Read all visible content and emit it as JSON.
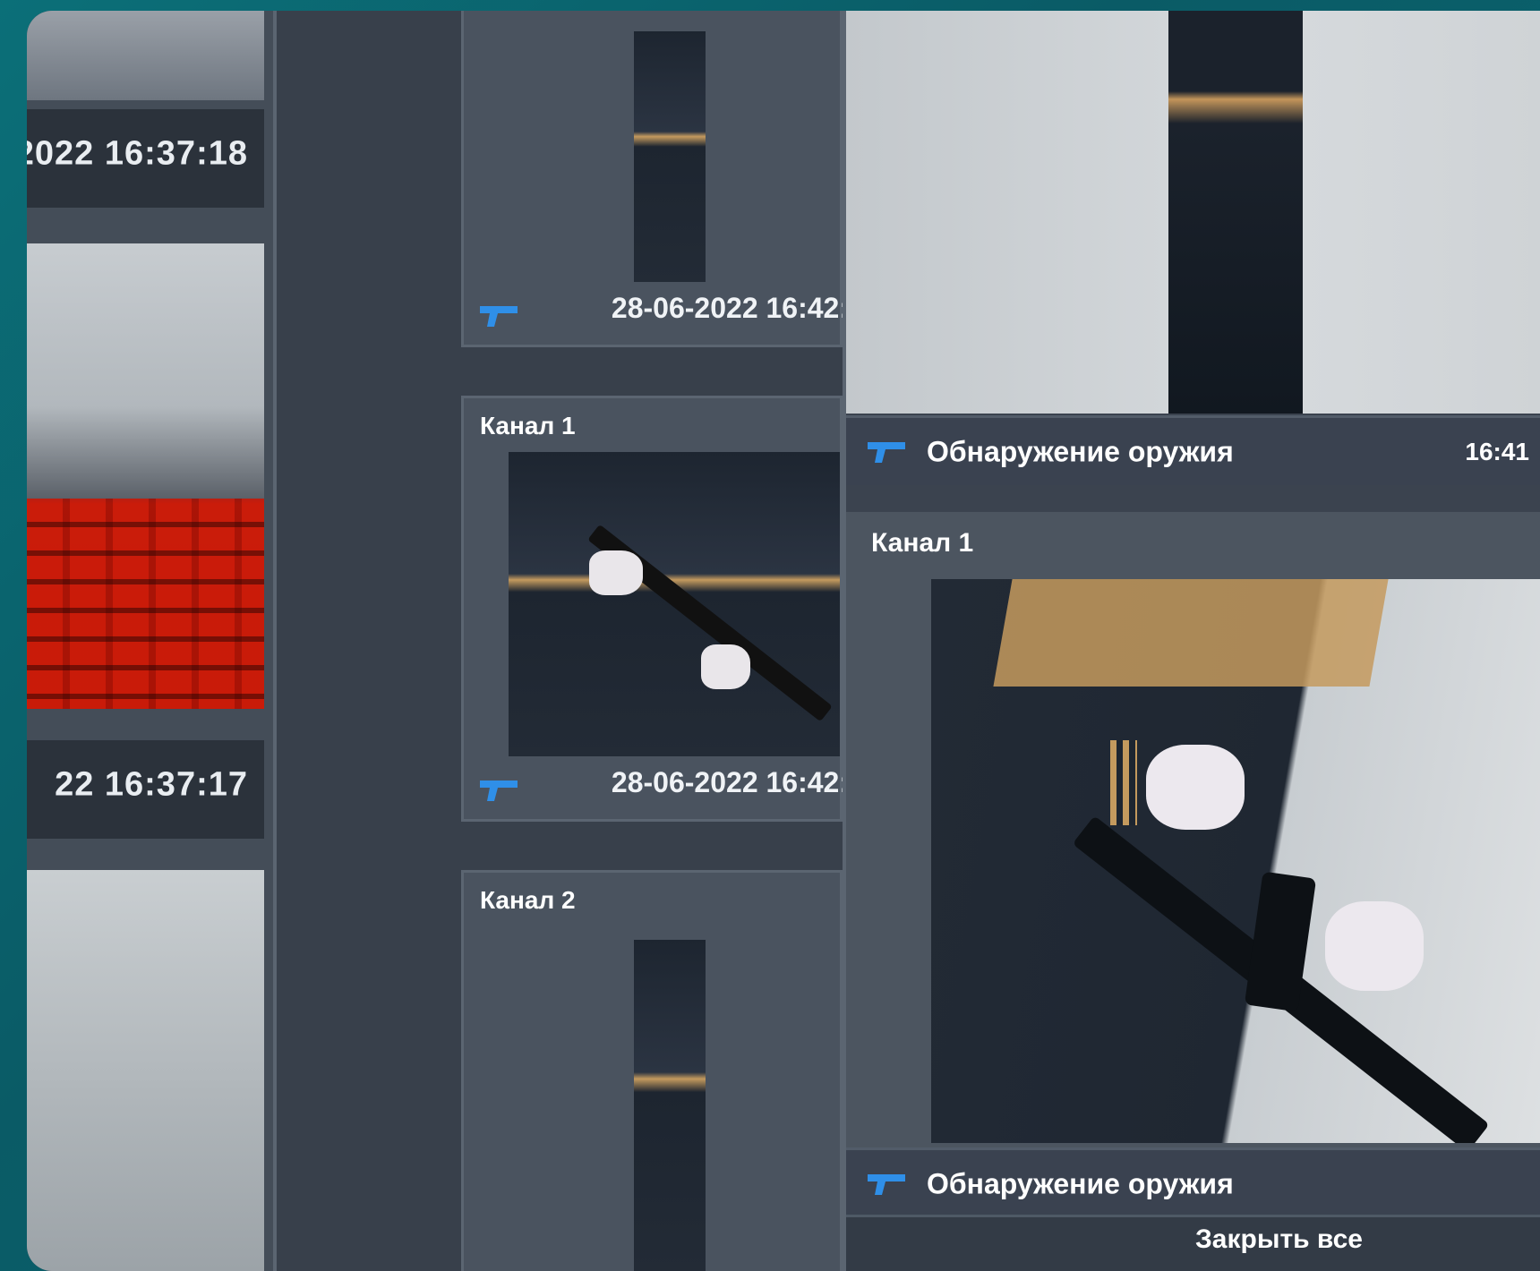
{
  "left_column": {
    "timestamps": [
      "2022 16:37:18",
      "22 16:37:17"
    ]
  },
  "middle_column": {
    "cards": [
      {
        "title": "",
        "date": "28-06-2022 16:42:"
      },
      {
        "title": "Канал 1",
        "date": "28-06-2022 16:42:"
      },
      {
        "title": "Канал 2",
        "date": ""
      }
    ]
  },
  "right_panel": {
    "events": [
      {
        "label": "Обнаружение оружия",
        "time": "16:41"
      },
      {
        "label": "Обнаружение оружия",
        "time": ""
      }
    ],
    "detail_title": "Канал 1",
    "close_all_label": "Закрыть все"
  },
  "icons": {
    "event_icon": "gun-icon",
    "accent_color": "#2f8fe8"
  }
}
